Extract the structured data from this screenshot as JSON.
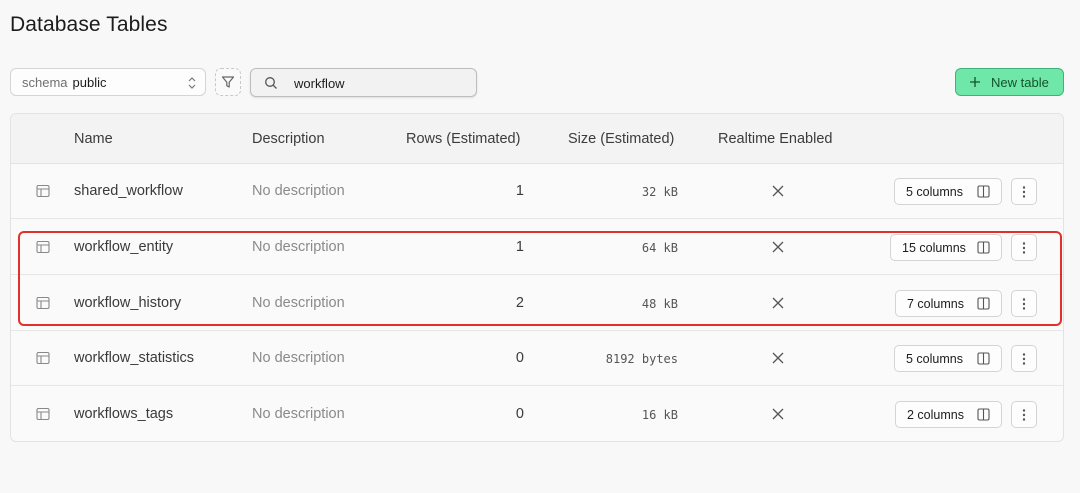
{
  "page": {
    "title": "Database Tables"
  },
  "toolbar": {
    "schema_label": "schema",
    "schema_value": "public",
    "search_value": "workflow",
    "new_table_label": "New table"
  },
  "table": {
    "headers": {
      "name": "Name",
      "description": "Description",
      "rows": "Rows (Estimated)",
      "size": "Size (Estimated)",
      "realtime": "Realtime Enabled"
    },
    "rows": [
      {
        "name": "shared_workflow",
        "description": "No description",
        "rows": "1",
        "size": "32 kB",
        "columns": "5 columns"
      },
      {
        "name": "workflow_entity",
        "description": "No description",
        "rows": "1",
        "size": "64 kB",
        "columns": "15 columns"
      },
      {
        "name": "workflow_history",
        "description": "No description",
        "rows": "2",
        "size": "48 kB",
        "columns": "7 columns"
      },
      {
        "name": "workflow_statistics",
        "description": "No description",
        "rows": "0",
        "size": "8192 bytes",
        "columns": "5 columns"
      },
      {
        "name": "workflows_tags",
        "description": "No description",
        "rows": "0",
        "size": "16 kB",
        "columns": "2 columns"
      }
    ]
  },
  "colors": {
    "accent_green": "#6ee7a8",
    "highlight_red": "#e0312b"
  },
  "icons": [
    "chevron-updown-icon",
    "filter-icon",
    "search-icon",
    "plus-icon",
    "table-icon",
    "x-icon",
    "columns-icon",
    "more-vertical-icon"
  ]
}
